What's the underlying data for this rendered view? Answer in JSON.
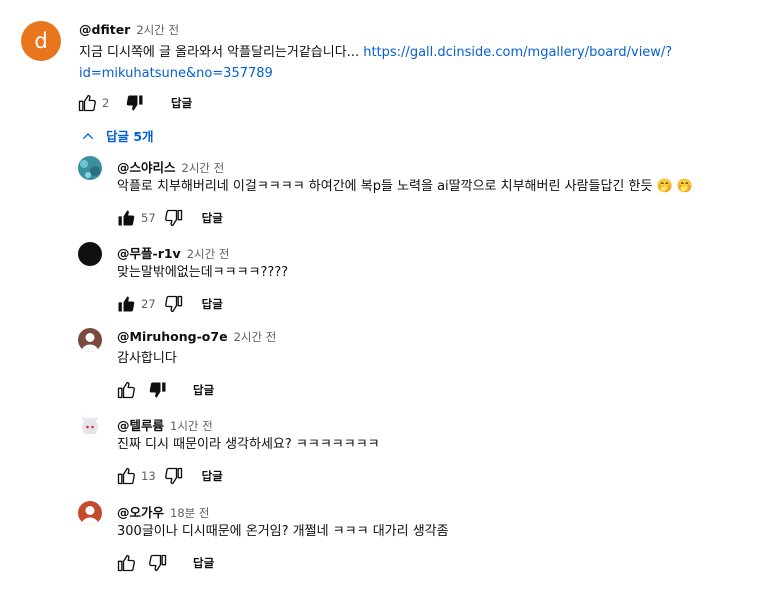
{
  "main_comment": {
    "avatar_letter": "d",
    "author": "@dfiter",
    "time": "2시간 전",
    "text": "지금 디시쪽에 글 올라와서 악플달리는거같습니다... ",
    "link_line1": "https://gall.dcinside.com/mgallery/board/view/?",
    "link_line2": "id=mikuhatsune&no=357789",
    "likes": "2",
    "reply_label": "답글"
  },
  "replies_toggle": {
    "label": "답글 5개",
    "icon": "chevron-up-icon"
  },
  "replies": [
    {
      "author": "@스야리스",
      "time": "2시간 전",
      "text": "악플로 치부해버리네 이걸ㅋㅋㅋㅋ 하여간에 복p들 노력을 ai딸깍으로 치부해버린 사람들답긴 한듯 🤭 🤭",
      "likes": "57",
      "liked": true,
      "disliked": false,
      "reply_label": "답글",
      "avatar": "teal-pattern"
    },
    {
      "author": "@무플-r1v",
      "time": "2시간 전",
      "text": "맞는말밖에없는데ㅋㅋㅋㅋ????",
      "likes": "27",
      "liked": true,
      "disliked": false,
      "reply_label": "답글",
      "avatar": "black"
    },
    {
      "author": "@Miruhong-o7e",
      "time": "2시간 전",
      "text": "감사합니다",
      "likes": "",
      "liked": false,
      "disliked": true,
      "reply_label": "답글",
      "avatar": "brown-person"
    },
    {
      "author": "@텔루륨",
      "time": "1시간 전",
      "text": "진짜 디시 때문이라 생각하세요? ㅋㅋㅋㅋㅋㅋㅋ",
      "likes": "13",
      "liked": false,
      "disliked": false,
      "reply_label": "답글",
      "avatar": "anime-character"
    },
    {
      "author": "@오가우",
      "time": "18분 전",
      "text": "300글이나 디시때문에 온거임? 개쩔네 ㅋㅋㅋ 대가리 생각좀",
      "likes": "",
      "liked": false,
      "disliked": false,
      "reply_label": "답글",
      "avatar": "red-person"
    }
  ],
  "colors": {
    "link": "#065fd4",
    "meta": "#606060",
    "main_avatar": "#e8761c"
  }
}
